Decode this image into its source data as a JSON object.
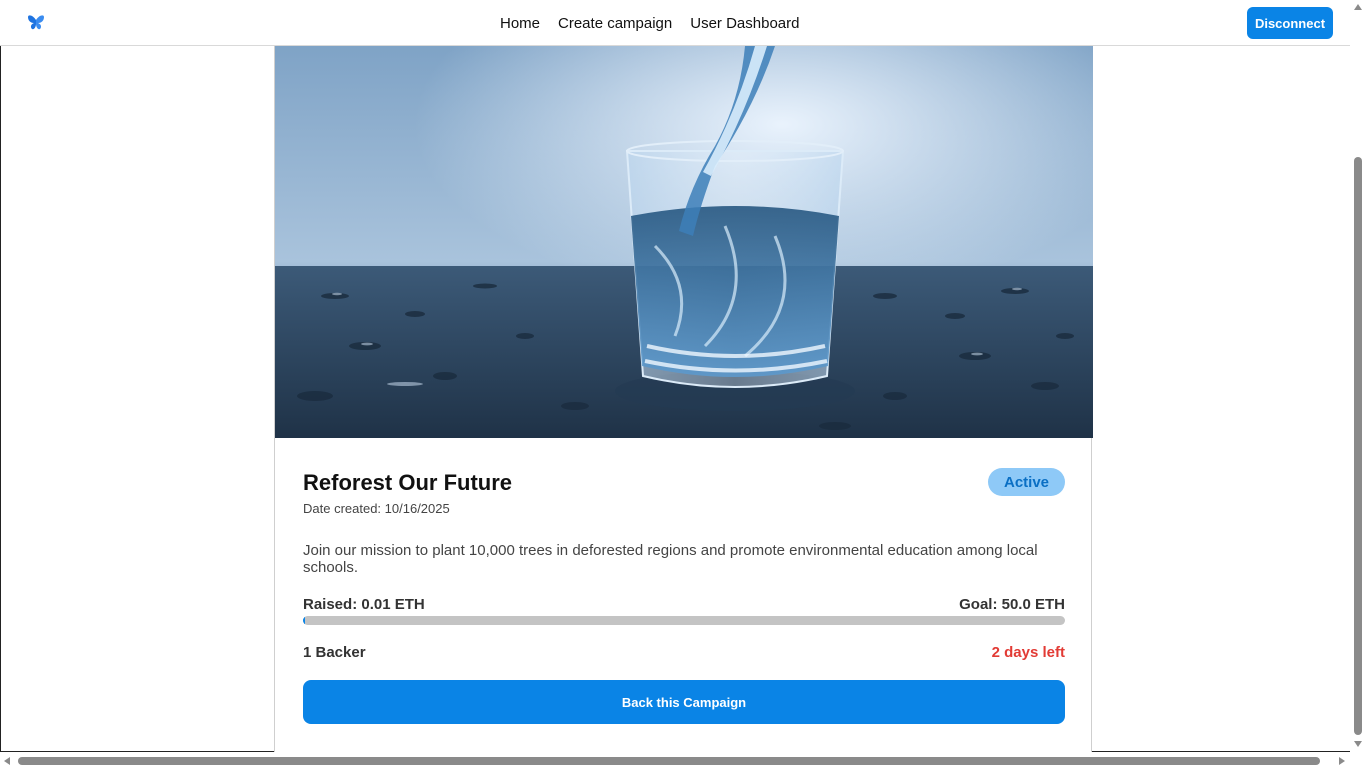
{
  "nav": {
    "logo_icon": "butterfly-logo-icon",
    "links": [
      "Home",
      "Create campaign",
      "User Dashboard"
    ],
    "disconnect_label": "Disconnect"
  },
  "campaign": {
    "image_icon": "water-glass-image",
    "title": "Reforest Our Future",
    "date_created": "Date created: 10/16/2025",
    "status": "Active",
    "description": "Join our mission to plant 10,000 trees in deforested regions and promote environmental education among local schools.",
    "raised": "Raised: 0.01 ETH",
    "goal": "Goal: 50.0 ETH",
    "progress_fraction": 0.0002,
    "backers": "1 Backer",
    "days_left": "2 days left",
    "back_button": "Back this Campaign"
  },
  "colors": {
    "accent": "#0a84e6",
    "badge_bg": "#8ec9f7",
    "days_left": "#e23b35"
  }
}
